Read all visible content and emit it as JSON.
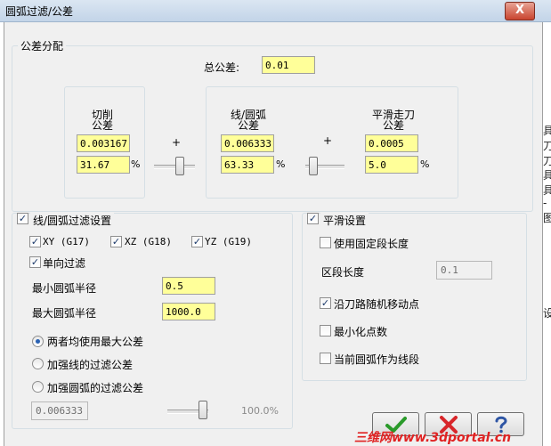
{
  "window": {
    "title": "圆弧过滤/公差",
    "close_label": "X"
  },
  "tolerance_group": {
    "legend": "公差分配",
    "total_label": "总公差:",
    "total_value": "0.01",
    "plus1": "+",
    "plus2": "+",
    "cut": {
      "label_line1": "切削",
      "label_line2": "公差",
      "value": "0.003167",
      "percent": "31.67",
      "percent_sign": "%"
    },
    "arc": {
      "label_line1": "线/圆弧",
      "label_line2": "公差",
      "value": "0.006333",
      "percent": "63.33",
      "percent_sign": "%"
    },
    "smooth": {
      "label_line1": "平滑走刀",
      "label_line2": "公差",
      "value": "0.0005",
      "percent": "5.0",
      "percent_sign": "%"
    }
  },
  "filter_group": {
    "legend": "线/圆弧过滤设置",
    "legend_checked": true,
    "xy_label": "XY (G17)",
    "xz_label": "XZ (G18)",
    "yz_label": "YZ (G19)",
    "one_way_label": "单向过滤",
    "min_radius_label": "最小圆弧半径",
    "min_radius_value": "0.5",
    "max_radius_label": "最大圆弧半径",
    "max_radius_value": "1000.0",
    "radio_both": "两者均使用最大公差",
    "radio_line": "加强线的过滤公差",
    "radio_arc": "加强圆弧的过滤公差",
    "disabled_value": "0.006333",
    "disabled_percent": "100.0%"
  },
  "smooth_group": {
    "legend": "平滑设置",
    "legend_checked": true,
    "fixed_segment_label": "使用固定段长度",
    "segment_length_label": "区段长度",
    "segment_length_value": "0.1",
    "random_move_label": "沿刀路随机移动点",
    "minimize_points_label": "最小化点数",
    "arc_as_line_label": "当前圆弧作为线段"
  },
  "buttons": {
    "ok_icon": "check-icon",
    "cancel_icon": "x-icon",
    "help_icon": "question-icon"
  },
  "colors": {
    "field_yellow": "#ffff99",
    "dialog_bg": "#f0f0f0",
    "ok_green": "#2a9a2a",
    "cancel_red": "#d8262a",
    "help_blue": "#2e55a4"
  },
  "right_strip": [
    "具",
    "刀",
    "刀",
    "具",
    "具",
    "-",
    "图",
    "设"
  ],
  "watermark": "三维网www.3dportal.cn"
}
